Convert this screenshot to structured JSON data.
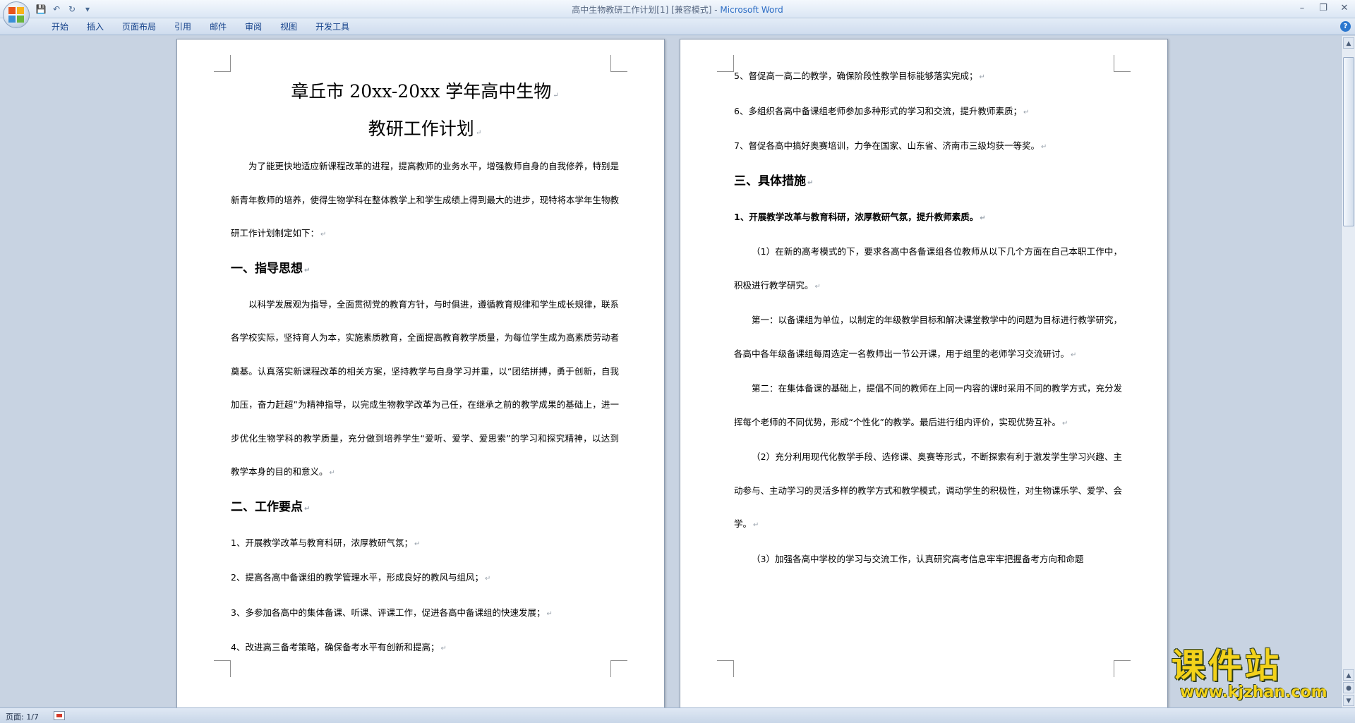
{
  "window": {
    "title_doc": "高中生物教研工作计划[1] [兼容模式] - ",
    "title_app": "Microsoft Word"
  },
  "qat": {
    "save_icon": "save-icon",
    "undo_icon": "undo-icon",
    "redo_icon": "redo-icon",
    "customize_icon": "customize-arrow-icon"
  },
  "ribbon": {
    "tabs": [
      "开始",
      "插入",
      "页面布局",
      "引用",
      "邮件",
      "审阅",
      "视图",
      "开发工具"
    ]
  },
  "page_left": {
    "title_line1": "章丘市 20xx-20xx 学年高中生物",
    "title_line2": "教研工作计划",
    "intro": "为了能更快地适应新课程改革的进程，提高教师的业务水平，增强教师自身的自我修养，特别是新青年教师的培养，使得生物学科在整体教学上和学生成绩上得到最大的进步，现特将本学年生物教研工作计划制定如下：",
    "heading1": "一、指导思想",
    "para1": "以科学发展观为指导，全面贯彻党的教育方针，与时俱进，遵循教育规律和学生成长规律，联系各学校实际，坚持育人为本，实施素质教育，全面提高教育教学质量，为每位学生成为高素质劳动者奠基。认真落实新课程改革的相关方案，坚持教学与自身学习并重，以“团结拼搏，勇于创新，自我加压，奋力赶超”为精神指导，以完成生物教学改革为己任，在继承之前的教学成果的基础上，进一步优化生物学科的教学质量，充分做到培养学生“爱听、爱学、爱思索”的学习和探究精神，以达到教学本身的目的和意义。",
    "heading2": "二、工作要点",
    "items": [
      "1、开展教学改革与教育科研，浓厚教研气氛；",
      "2、提高各高中备课组的教学管理水平，形成良好的教风与组风；",
      "3、多参加各高中的集体备课、听课、评课工作，促进各高中备课组的快速发展；",
      "4、改进高三备考策略，确保备考水平有创新和提高；"
    ]
  },
  "page_right": {
    "items": [
      "5、督促高一高二的教学，确保阶段性教学目标能够落实完成；",
      "6、多组织各高中备课组老师参加多种形式的学习和交流，提升教师素质；",
      "7、督促各高中搞好奥赛培训，力争在国家、山东省、济南市三级均获一等奖。"
    ],
    "heading3": "三、具体措施",
    "sub1": "1、开展教学改革与教育科研，浓厚教研气氛，提升教师素质。",
    "p1": "（1）在新的高考模式的下，要求各高中各备课组各位教师从以下几个方面在自己本职工作中，积极进行教学研究。",
    "p2": "第一：以备课组为单位，以制定的年级教学目标和解决课堂教学中的问题为目标进行教学研究，各高中各年级备课组每周选定一名教师出一节公开课，用于组里的老师学习交流研讨。",
    "p3": "第二：在集体备课的基础上，提倡不同的教师在上同一内容的课时采用不同的教学方式，充分发挥每个老师的不同优势，形成“个性化”的教学。最后进行组内评价，实现优势互补。",
    "p4": "（2）充分利用现代化教学手段、选修课、奥赛等形式，不断探索有利于激发学生学习兴趣、主动参与、主动学习的灵活多样的教学方式和教学模式，调动学生的积极性，对生物课乐学、爱学、会学。",
    "p5": "（3）加强各高中学校的学习与交流工作，认真研究高考信息牢牢把握备考方向和命题"
  },
  "status": {
    "page": "页面: 1/7"
  },
  "watermark": {
    "logo": "课件站",
    "url": "www.kjzhan.com"
  },
  "colors": {
    "app_title": "#2b6cc4",
    "tab_text": "#15428b",
    "background": "#c8d3e2",
    "watermark": "#f3d21a"
  }
}
